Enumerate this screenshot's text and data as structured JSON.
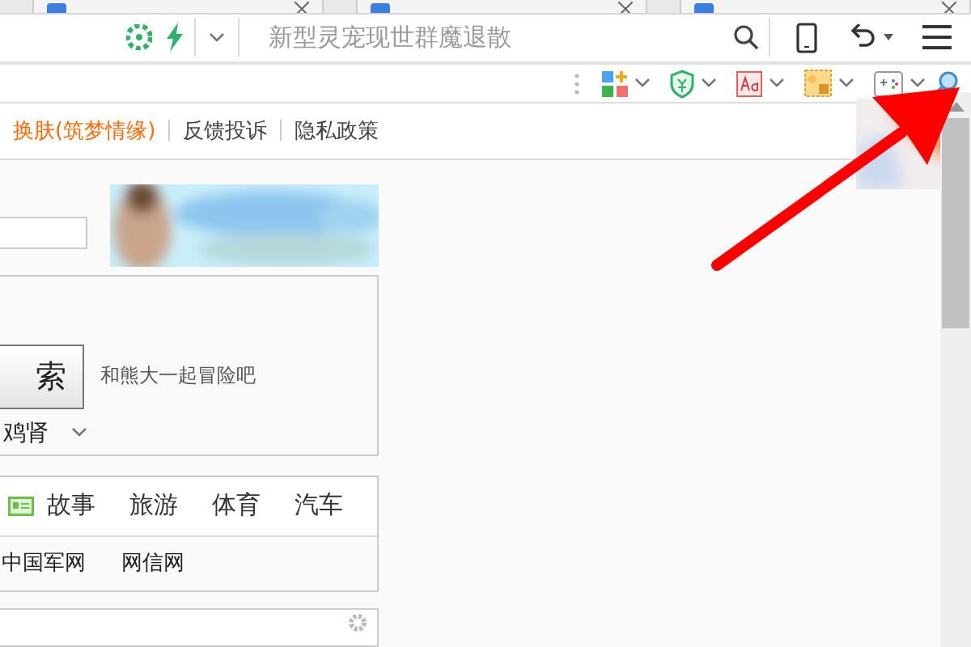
{
  "tabs": [
    {
      "kind": "page"
    },
    {
      "kind": "page"
    },
    {
      "kind": "page"
    }
  ],
  "address_bar": {
    "placeholder": "新型灵宠现世群魔退散"
  },
  "link_bar": [
    {
      "label": "换肤(筑梦情缘)",
      "highlighted": true
    },
    {
      "label": "反馈投诉",
      "highlighted": false
    },
    {
      "label": "隐私政策",
      "highlighted": false
    }
  ],
  "search_panel": {
    "button": "索",
    "slogan": "和熊大一起冒险吧",
    "dropdown": "鸡肾"
  },
  "categories": [
    "故事",
    "旅游",
    "体育",
    "汽车"
  ],
  "sites": [
    "中国军网",
    "网信网"
  ]
}
